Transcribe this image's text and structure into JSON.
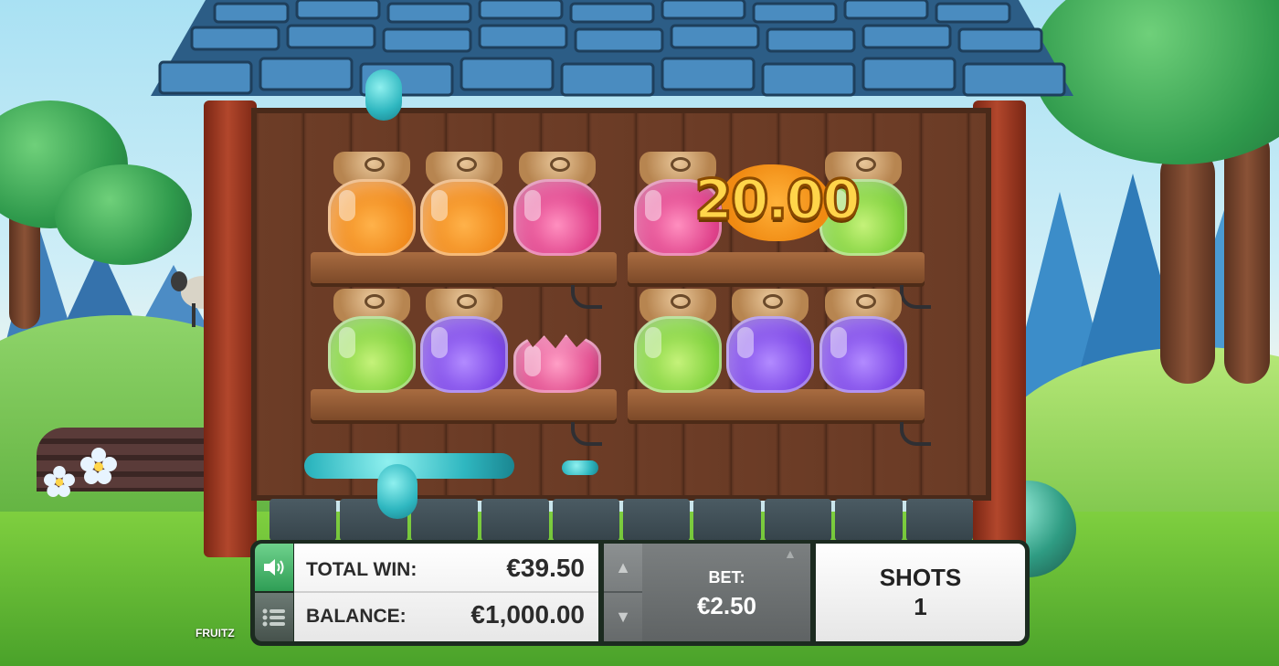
{
  "game": {
    "brand": "FRUITZ",
    "win_popup": "20.00"
  },
  "panel": {
    "total_win_label": "TOTAL WIN:",
    "total_win_value": "€39.50",
    "balance_label": "BALANCE:",
    "balance_value": "€1,000.00",
    "bet_label": "BET:",
    "bet_value": "€2.50",
    "shots_label": "SHOTS",
    "shots_value": "1"
  },
  "controls": {
    "sound_icon": "speaker-icon",
    "menu_icon": "menu-list-icon",
    "bet_up_icon": "chevron-up-icon",
    "bet_down_icon": "chevron-down-icon"
  },
  "jars": {
    "top_shelf": [
      "orange",
      "orange",
      "pink",
      "pink",
      "splash",
      "green"
    ],
    "bottom_shelf": [
      "green",
      "purple",
      "broken-pink",
      "green",
      "purple",
      "purple"
    ]
  },
  "colors": {
    "sound_button": "#3fb56a",
    "win_text": "#ffd54a",
    "panel_frame": "#1c2b20"
  }
}
